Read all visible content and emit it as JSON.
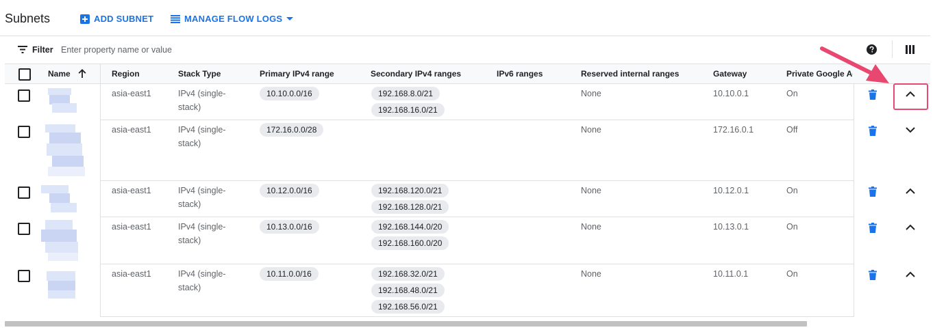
{
  "page": {
    "title": "Subnets",
    "add_subnet_label": "ADD SUBNET",
    "manage_flow_logs_label": "MANAGE FLOW LOGS"
  },
  "filter": {
    "label": "Filter",
    "placeholder": "Enter property name or value"
  },
  "table": {
    "columns": {
      "name": "Name",
      "region": "Region",
      "stack_type": "Stack Type",
      "primary_ipv4": "Primary IPv4 range",
      "secondary_ipv4": "Secondary IPv4 ranges",
      "ipv6": "IPv6 ranges",
      "reserved": "Reserved internal ranges",
      "gateway": "Gateway",
      "private_google_access": "Private Google Access"
    },
    "sort": {
      "column": "name",
      "direction": "ascending"
    },
    "rows": [
      {
        "region": "asia-east1",
        "stack_type_line1": "IPv4 (single-",
        "stack_type_line2": "stack)",
        "primary": "10.10.0.0/16",
        "secondary": [
          "192.168.8.0/21",
          "192.168.16.0/21"
        ],
        "reserved": "None",
        "gateway": "10.10.0.1",
        "private_access": "On",
        "expanded": true
      },
      {
        "region": "asia-east1",
        "stack_type_line1": "IPv4 (single-",
        "stack_type_line2": "stack)",
        "primary": "172.16.0.0/28",
        "secondary": [],
        "reserved": "None",
        "gateway": "172.16.0.1",
        "private_access": "Off",
        "expanded": false
      },
      {
        "region": "asia-east1",
        "stack_type_line1": "IPv4 (single-",
        "stack_type_line2": "stack)",
        "primary": "10.12.0.0/16",
        "secondary": [
          "192.168.120.0/21",
          "192.168.128.0/21"
        ],
        "reserved": "None",
        "gateway": "10.12.0.1",
        "private_access": "On",
        "expanded": true
      },
      {
        "region": "asia-east1",
        "stack_type_line1": "IPv4 (single-",
        "stack_type_line2": "stack)",
        "primary": "10.13.0.0/16",
        "secondary": [
          "192.168.144.0/20",
          "192.168.160.0/20"
        ],
        "reserved": "None",
        "gateway": "10.13.0.1",
        "private_access": "On",
        "expanded": true
      },
      {
        "region": "asia-east1",
        "stack_type_line1": "IPv4 (single-",
        "stack_type_line2": "stack)",
        "primary": "10.11.0.0/16",
        "secondary": [
          "192.168.32.0/21",
          "192.168.48.0/21",
          "192.168.56.0/21"
        ],
        "reserved": "None",
        "gateway": "10.11.0.1",
        "private_access": "On",
        "expanded": true
      }
    ]
  },
  "icons": {
    "add": "add-box-icon",
    "flow_logs": "list-icon",
    "dropdown": "caret-down-icon",
    "filter": "filter-icon",
    "help": "help-icon",
    "columns": "column-display-icon",
    "sort": "arrow-up-icon",
    "delete": "trash-icon",
    "expand": "chevron-icon"
  },
  "colors": {
    "accent": "#1a73e8",
    "annotation": "#e8476f",
    "chip_bg": "#e8eaed"
  }
}
